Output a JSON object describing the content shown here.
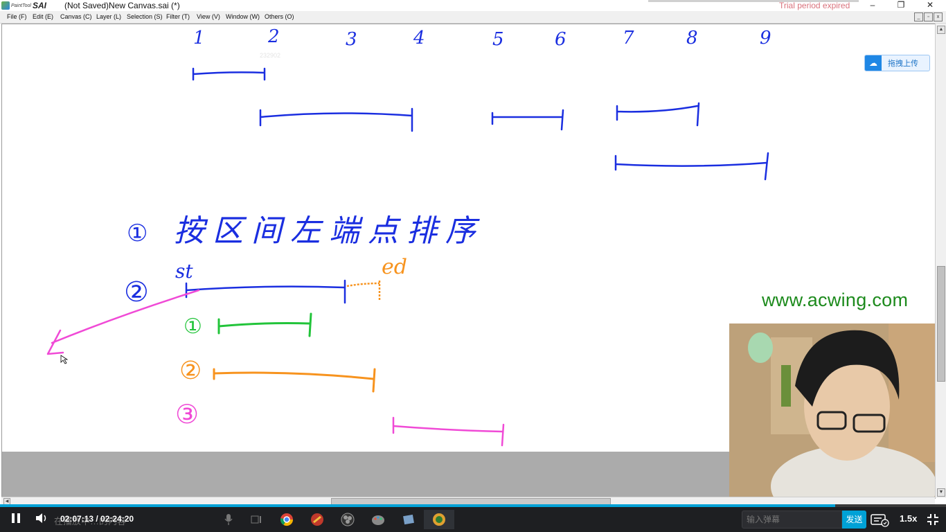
{
  "app": {
    "logo_small": "PaintTool",
    "logo_big": "SAI",
    "document_title": "(Not Saved)New Canvas.sai (*)",
    "trial_notice": "Trial period expired",
    "colors": {
      "trial": "#d9727c",
      "accent": "#00a1d6"
    }
  },
  "window_controls": {
    "minimize": "–",
    "restore": "❐",
    "close": "✕"
  },
  "menu": [
    {
      "label": "File (F)"
    },
    {
      "label": "Edit (E)"
    },
    {
      "label": "Canvas (C)"
    },
    {
      "label": "Layer (L)"
    },
    {
      "label": "Selection (S)"
    },
    {
      "label": "Filter (T)"
    },
    {
      "label": "View (V)"
    },
    {
      "label": "Window (W)"
    },
    {
      "label": "Others (O)"
    }
  ],
  "canvas": {
    "faint_text": "232902",
    "handwriting": {
      "numbers": [
        "1",
        "2",
        "3",
        "4",
        "5",
        "6",
        "7",
        "8",
        "9"
      ],
      "step1_marker": "①",
      "step1_text": "按区间左端点排序",
      "step2_marker": "②",
      "st_label": "st",
      "ed_label": "ed",
      "sub1": "①",
      "sub2": "②",
      "sub3": "③"
    },
    "ink_colors": {
      "blue": "#1a2ee0",
      "orange": "#f7931e",
      "green": "#22c43a",
      "magenta": "#f04ad6"
    }
  },
  "overlay": {
    "upload_button": "拖拽上传",
    "watermark": "www.acwing.com"
  },
  "player": {
    "time_display": "02:07:13 / 02:24:20",
    "danmaku_ghost_text": "在播放中…的内容",
    "progress": 0.883,
    "danmaku_placeholder": "输入弹幕",
    "send_label": "发送",
    "speed": "1.5x"
  },
  "icons": {
    "pause": "pause-icon",
    "volume": "volume-icon",
    "mic": "microphone-icon",
    "task_view": "task-view-icon",
    "chrome": "chrome-icon",
    "sai": "sai-app-icon",
    "obs": "obs-icon",
    "paint": "paint-icon",
    "app": "app-icon",
    "ps": "ps-icon",
    "danmaku_settings": "danmaku-settings-icon",
    "exit_fullscreen": "exit-fullscreen-icon"
  }
}
